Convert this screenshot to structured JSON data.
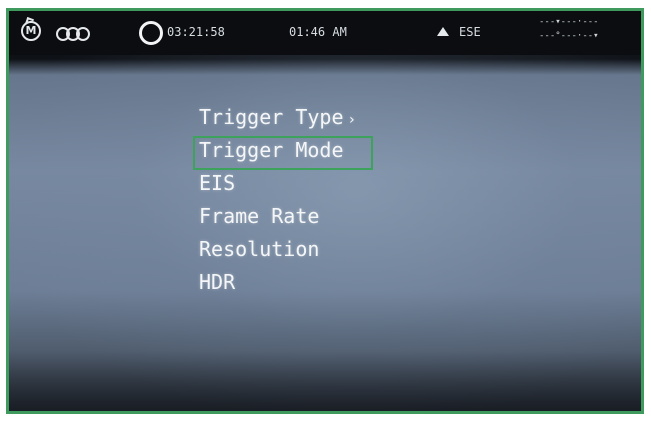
{
  "status_bar": {
    "mode_icon_label": "M",
    "mode_icon": "mode-m-rotate-icon",
    "dual_circle_icon": "triple-circle-icon",
    "record_icon": "record-ring-icon",
    "timer": "03:21:58",
    "clock": "01:46 AM",
    "heading_icon": "heading-arrow-icon",
    "heading": "ESE",
    "compass_scale_lines": [
      "---▾---·---",
      "---°---·--▾"
    ]
  },
  "menu": {
    "items": [
      {
        "label": "Trigger Type",
        "has_submenu": true,
        "selected": false
      },
      {
        "label": "Trigger Mode",
        "has_submenu": false,
        "selected": true
      },
      {
        "label": "EIS",
        "has_submenu": false,
        "selected": false
      },
      {
        "label": "Frame Rate",
        "has_submenu": false,
        "selected": false
      },
      {
        "label": "Resolution",
        "has_submenu": false,
        "selected": false
      },
      {
        "label": "HDR",
        "has_submenu": false,
        "selected": false
      }
    ],
    "submenu_glyph": "›"
  },
  "colors": {
    "frame_border": "#3f9a5e",
    "selection_border": "#3da35c",
    "status_bar_bg": "#0b0d10",
    "text": "#f4f6f8"
  }
}
